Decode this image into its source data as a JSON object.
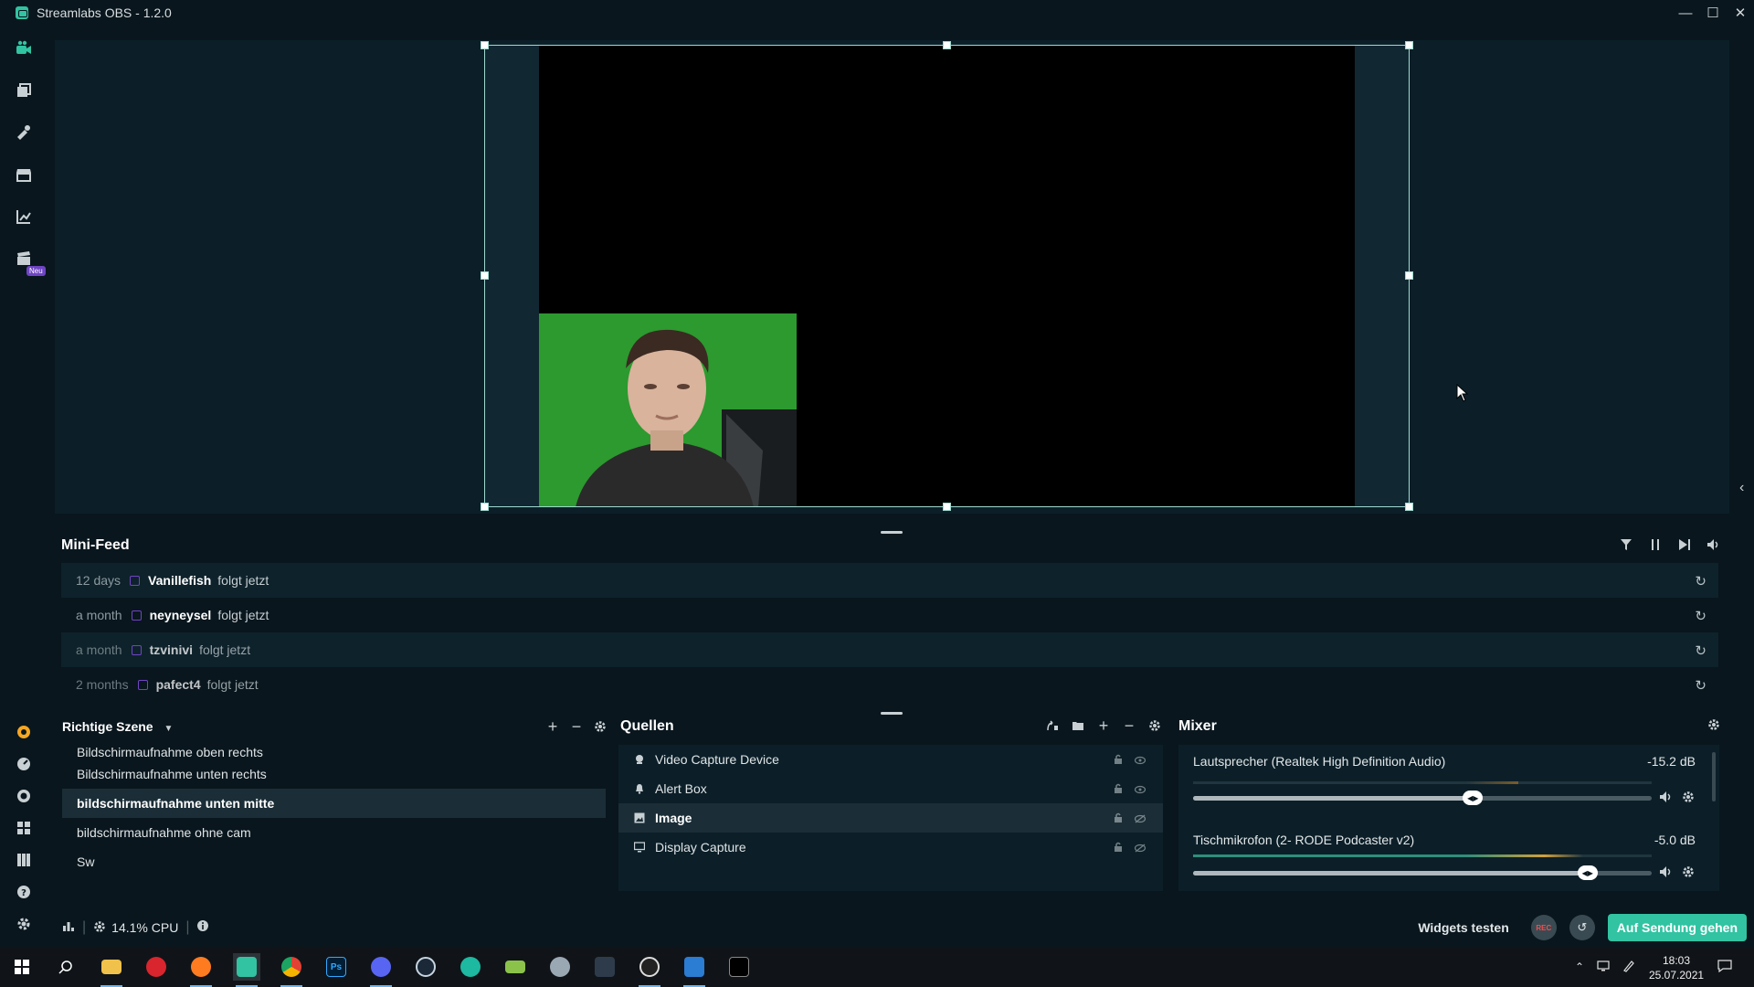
{
  "window": {
    "title": "Streamlabs OBS - 1.2.0"
  },
  "nav": {
    "new_badge": "Neu"
  },
  "minifeed": {
    "title": "Mini-Feed",
    "items": [
      {
        "time": "12 days",
        "user": "Vanillefish",
        "action": "folgt jetzt"
      },
      {
        "time": "a month",
        "user": "neyneysel",
        "action": "folgt jetzt"
      },
      {
        "time": "a month",
        "user": "tzvinivi",
        "action": "folgt jetzt"
      },
      {
        "time": "2 months",
        "user": "pafect4",
        "action": "folgt jetzt"
      }
    ]
  },
  "scenes": {
    "title": "Richtige Szene",
    "items": [
      {
        "label": "Bildschirmaufnahme oben rechts"
      },
      {
        "label": "Bildschirmaufnahme unten rechts"
      },
      {
        "label": "bildschirmaufnahme unten mitte",
        "active": true
      },
      {
        "label": "bildschirmaufnahme ohne cam"
      },
      {
        "label": "Sw"
      }
    ]
  },
  "sources": {
    "title": "Quellen",
    "items": [
      {
        "label": "Video Capture Device",
        "icon": "webcam-icon"
      },
      {
        "label": "Alert Box",
        "icon": "bell-icon"
      },
      {
        "label": "Image",
        "icon": "image-icon",
        "active": true
      },
      {
        "label": "Display Capture",
        "icon": "monitor-icon"
      }
    ]
  },
  "mixer": {
    "title": "Mixer",
    "channels": [
      {
        "name": "Lautsprecher (Realtek High Definition Audio)",
        "db": "-15.2 dB",
        "level": 0.61
      },
      {
        "name": "Tischmikrofon (2- RODE Podcaster v2)",
        "db": "-5.0 dB",
        "level": 0.86
      }
    ]
  },
  "status": {
    "cpu": "14.1% CPU",
    "widgets": "Widgets testen",
    "rec": "REC",
    "go_live": "Auf Sendung gehen"
  },
  "taskbar": {
    "time": "18:03",
    "date": "25.07.2021"
  },
  "colors": {
    "accent": "#31c3a2",
    "bg": "#09161d",
    "panel": "#0c1f28",
    "twitch": "#6f45c4"
  }
}
